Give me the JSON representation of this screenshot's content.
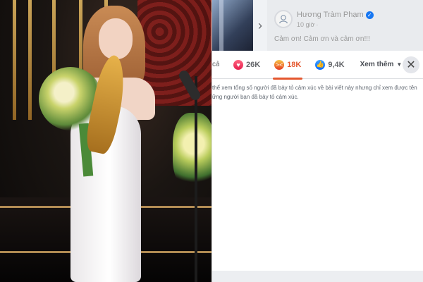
{
  "post": {
    "author": "Hương Tràm Phạm",
    "time": "10 giờ",
    "caption": "Cảm ơn! Cảm ơn và cảm ơn!!!"
  },
  "reactions": {
    "all_tab": "cả",
    "tabs": [
      {
        "icon": "heart-icon",
        "count": "26K"
      },
      {
        "icon": "angry-icon",
        "count": "18K",
        "active": true
      },
      {
        "icon": "like-icon",
        "count": "9,4K"
      }
    ],
    "more_label": "Xem thêm",
    "notice_line1": "thể xem tổng số người đã bày tỏ cảm xúc về bài viết này nhưng chỉ xem được tên",
    "notice_line2": "ững người bạn đã bày tỏ cảm xúc."
  },
  "colors": {
    "facebook_blue": "#1877f2",
    "angry_accent": "#e4572e"
  }
}
